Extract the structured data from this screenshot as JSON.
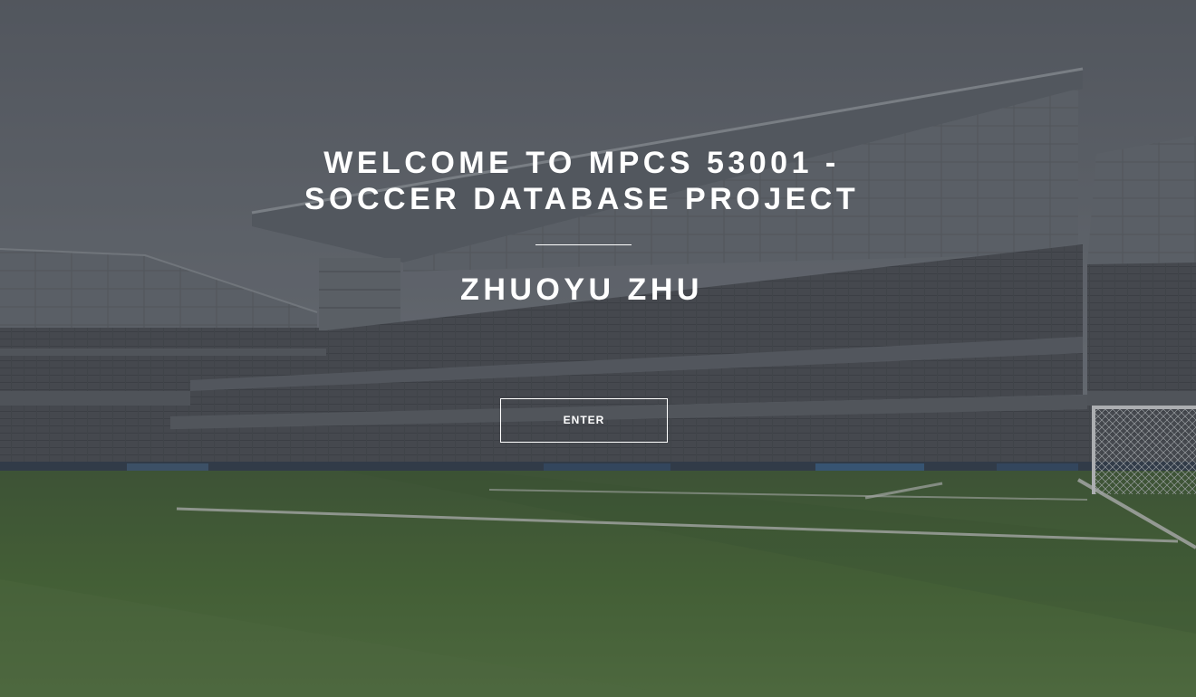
{
  "hero": {
    "title_line1": "WELCOME TO MPCS 53001 -",
    "title_line2": "SOCCER DATABASE PROJECT",
    "subtitle": "ZHUOYU ZHU",
    "enter_label": "ENTER"
  },
  "colors": {
    "text": "#ffffff",
    "overlay": "#3c4046",
    "pitch": "#3f6a2c",
    "sky": "#7a8088"
  }
}
